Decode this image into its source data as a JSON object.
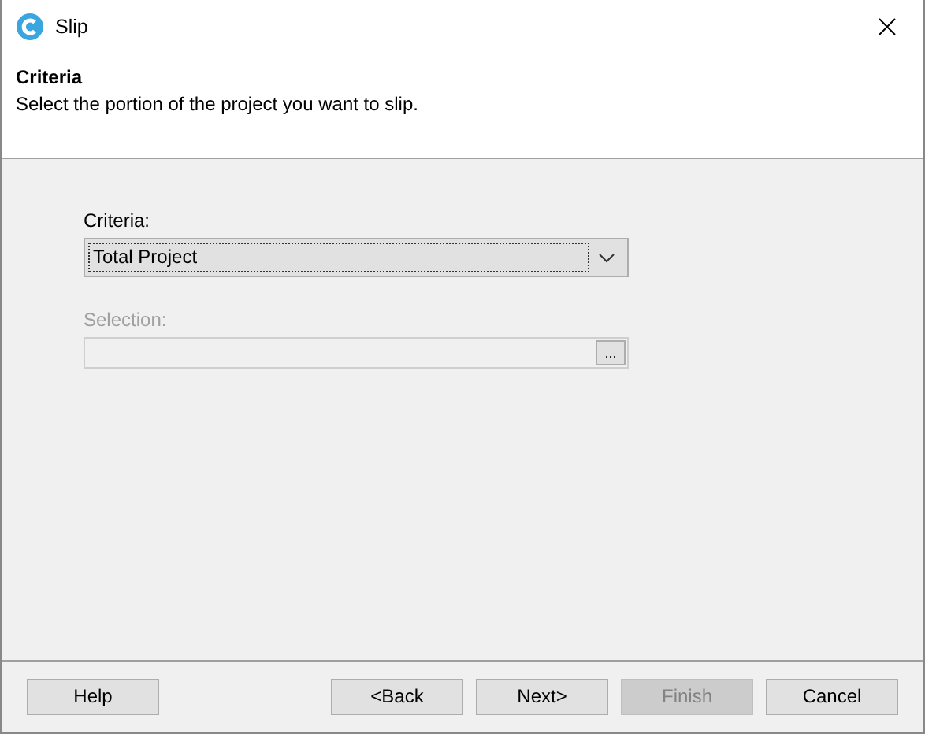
{
  "window": {
    "title": "Slip"
  },
  "header": {
    "title": "Criteria",
    "description": "Select the portion of the project you want to slip."
  },
  "criteria": {
    "label": "Criteria:",
    "value": "Total Project"
  },
  "selection": {
    "label": "Selection:",
    "browse": "...",
    "disabled": true
  },
  "buttons": [
    {
      "label": "Help",
      "disabled": false
    },
    {
      "label": "<Back",
      "disabled": false
    },
    {
      "label": "Next>",
      "disabled": false
    },
    {
      "label": "Finish",
      "disabled": true
    },
    {
      "label": "Cancel",
      "disabled": false
    }
  ]
}
